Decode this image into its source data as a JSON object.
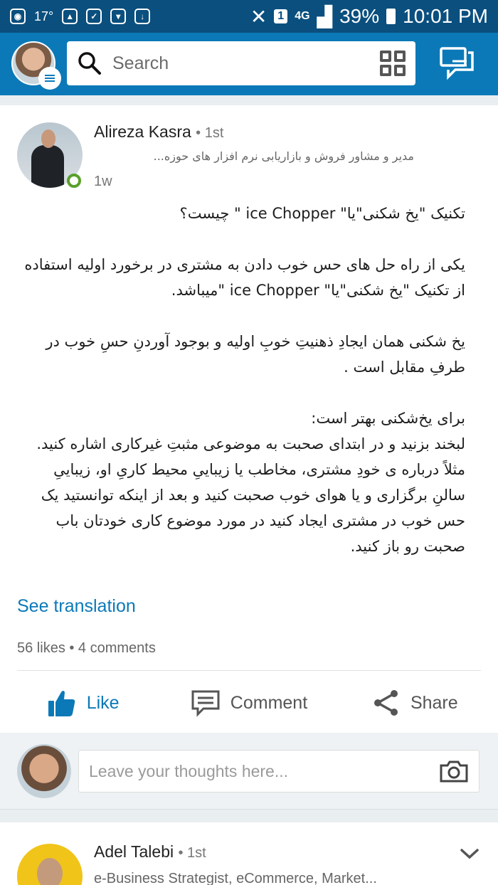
{
  "status_bar": {
    "temperature": "17°",
    "network_type": "4G",
    "sim_slot": "1",
    "battery": "39%",
    "time": "10:01 PM"
  },
  "header": {
    "search_placeholder": "Search",
    "icons": [
      "profile-avatar",
      "menu-icon",
      "search-icon",
      "qr-code-icon",
      "messages-icon"
    ]
  },
  "post": {
    "author": "Alireza Kasra",
    "degree": "• 1st",
    "headline": "مدیر و مشاور فروش و بازاریابی نرم افزار های حوزه...",
    "time": "1w",
    "text": "تکنیک \"یخ شکنی\"یا\" ice Chopper \" چیست؟\n\nیکی از راه حل های حس خوب دادن به مشتری در برخورد اولیه استفاده از  تکنیک \"یخ شکنی\"یا\" ice Chopper \"میباشد.\n\nیخ شکنی همان ایجادِ ذهنیتِ خوبِ اولیه و بوجود آوردنِ حسِ خوب در طرفِ مقابل است .\n\nبرای یخ‌شکنی بهتر است:\nلبخند بزنید و در ابتدای صحبت به موضوعی مثبتِ غیرکاری اشاره کنید.\nمثلاً درباره ی خودِ مشتری، مخاطب یا زیباییِ محیط کاریِ او، زیباییِ سالنِ برگزاری و یا هوای خوب صحبت کنید و بعد از اینکه توانستید یک حس خوب در مشتری ایجاد کنید در مورد موضوع کاری خودتان باب صحبت رو باز کنید.",
    "see_translation": "See translation",
    "counts": "56 likes • 4 comments",
    "actions": {
      "like": "Like",
      "comment": "Comment",
      "share": "Share"
    }
  },
  "comment_box": {
    "placeholder": "Leave your thoughts here..."
  },
  "next_post": {
    "author": "Adel Talebi",
    "degree": "• 1st",
    "headline": "e-Business Strategist, eCommerce, Market..."
  },
  "colors": {
    "status_bar": "#0a4f7e",
    "brand": "#0b79b8",
    "online": "#5aa02c"
  }
}
